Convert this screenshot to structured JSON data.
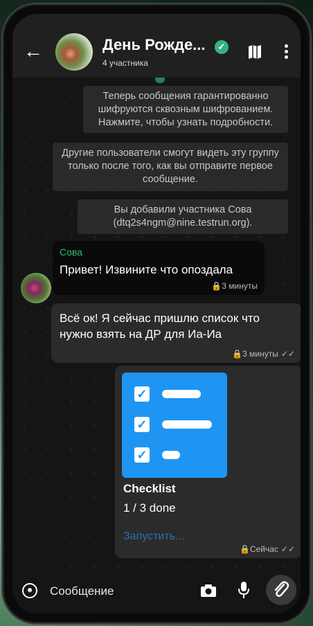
{
  "header": {
    "title": "День Рожде...",
    "subtitle": "4 участника"
  },
  "notices": [
    "Теперь сообщения гарантированно шифруются сквозным шифрованием. Нажмите, чтобы узнать подробности.",
    "Другие пользователи смогут видеть эту группу только после того, как вы отправите первое сообщение.",
    "Вы добавили участника Сова (dtq2s4ngm@nine.testrun.org)."
  ],
  "messages": [
    {
      "sender": "Сова",
      "text": "Привет! Извините что опоздала",
      "time": "3 минуты"
    },
    {
      "text": "Всё ок! Я сейчас пришлю список что нужно взять на ДР для Иа-Иа",
      "time": "3 минуты"
    }
  ],
  "app_card": {
    "title": "Checklist",
    "progress": "1 / 3 done",
    "action": "Запустить...",
    "time": "Сейчас"
  },
  "composer": {
    "placeholder": "Сообщение"
  },
  "colors": {
    "accent_green": "#2fbb6f",
    "checklist_blue": "#1e95f3",
    "link_blue": "#2a6fb0"
  }
}
